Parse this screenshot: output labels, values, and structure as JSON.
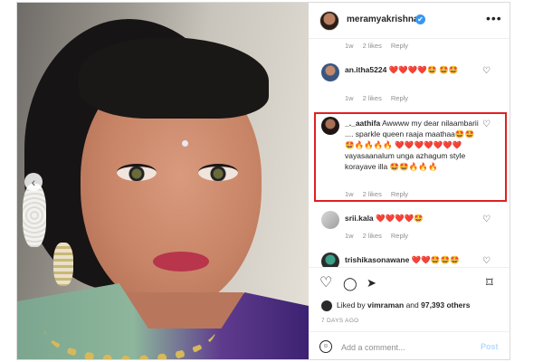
{
  "header": {
    "username": "meramyakrishnan",
    "verified_glyph": "✔",
    "more_glyph": "•••"
  },
  "photo": {
    "prev_glyph": "‹"
  },
  "comments": [
    {
      "username": "",
      "text": "",
      "time": "1w",
      "likes": "2 likes",
      "reply": "Reply"
    },
    {
      "username": "an.itha5224",
      "text": " ❤️❤️❤️❤️🤩 🤩🤩",
      "time": "1w",
      "likes": "2 likes",
      "reply": "Reply"
    },
    {
      "username": "_._aathifa",
      "text": " Awwww my dear nilaambarii .... sparkle queen raaja maathaa🤩🤩🤩🔥🔥🔥🔥 ❤️❤️❤️❤️❤️❤️❤️ vayasaanalum unga azhagum style korayave illa 🤩🤩🔥🔥🔥",
      "time": "1w",
      "likes": "2 likes",
      "reply": "Reply"
    },
    {
      "username": "srii.kala",
      "text": " ❤️❤️❤️❤️🤩",
      "time": "1w",
      "likes": "2 likes",
      "reply": "Reply"
    },
    {
      "username": "trishikasonawane",
      "text": " ❤️❤️🤩🤩🤩",
      "time": "",
      "likes": "",
      "reply": ""
    }
  ],
  "actions": {
    "heart_glyph": "♡",
    "comment_glyph": "◯",
    "share_glyph": "➤",
    "save_glyph": "⌑",
    "liked_prefix": "Liked by ",
    "liked_user": "vimraman",
    "liked_mid": " and ",
    "liked_count": "97,393 others",
    "days_ago": "7 DAYS AGO",
    "add_placeholder": "Add a comment...",
    "post_label": "Post"
  }
}
